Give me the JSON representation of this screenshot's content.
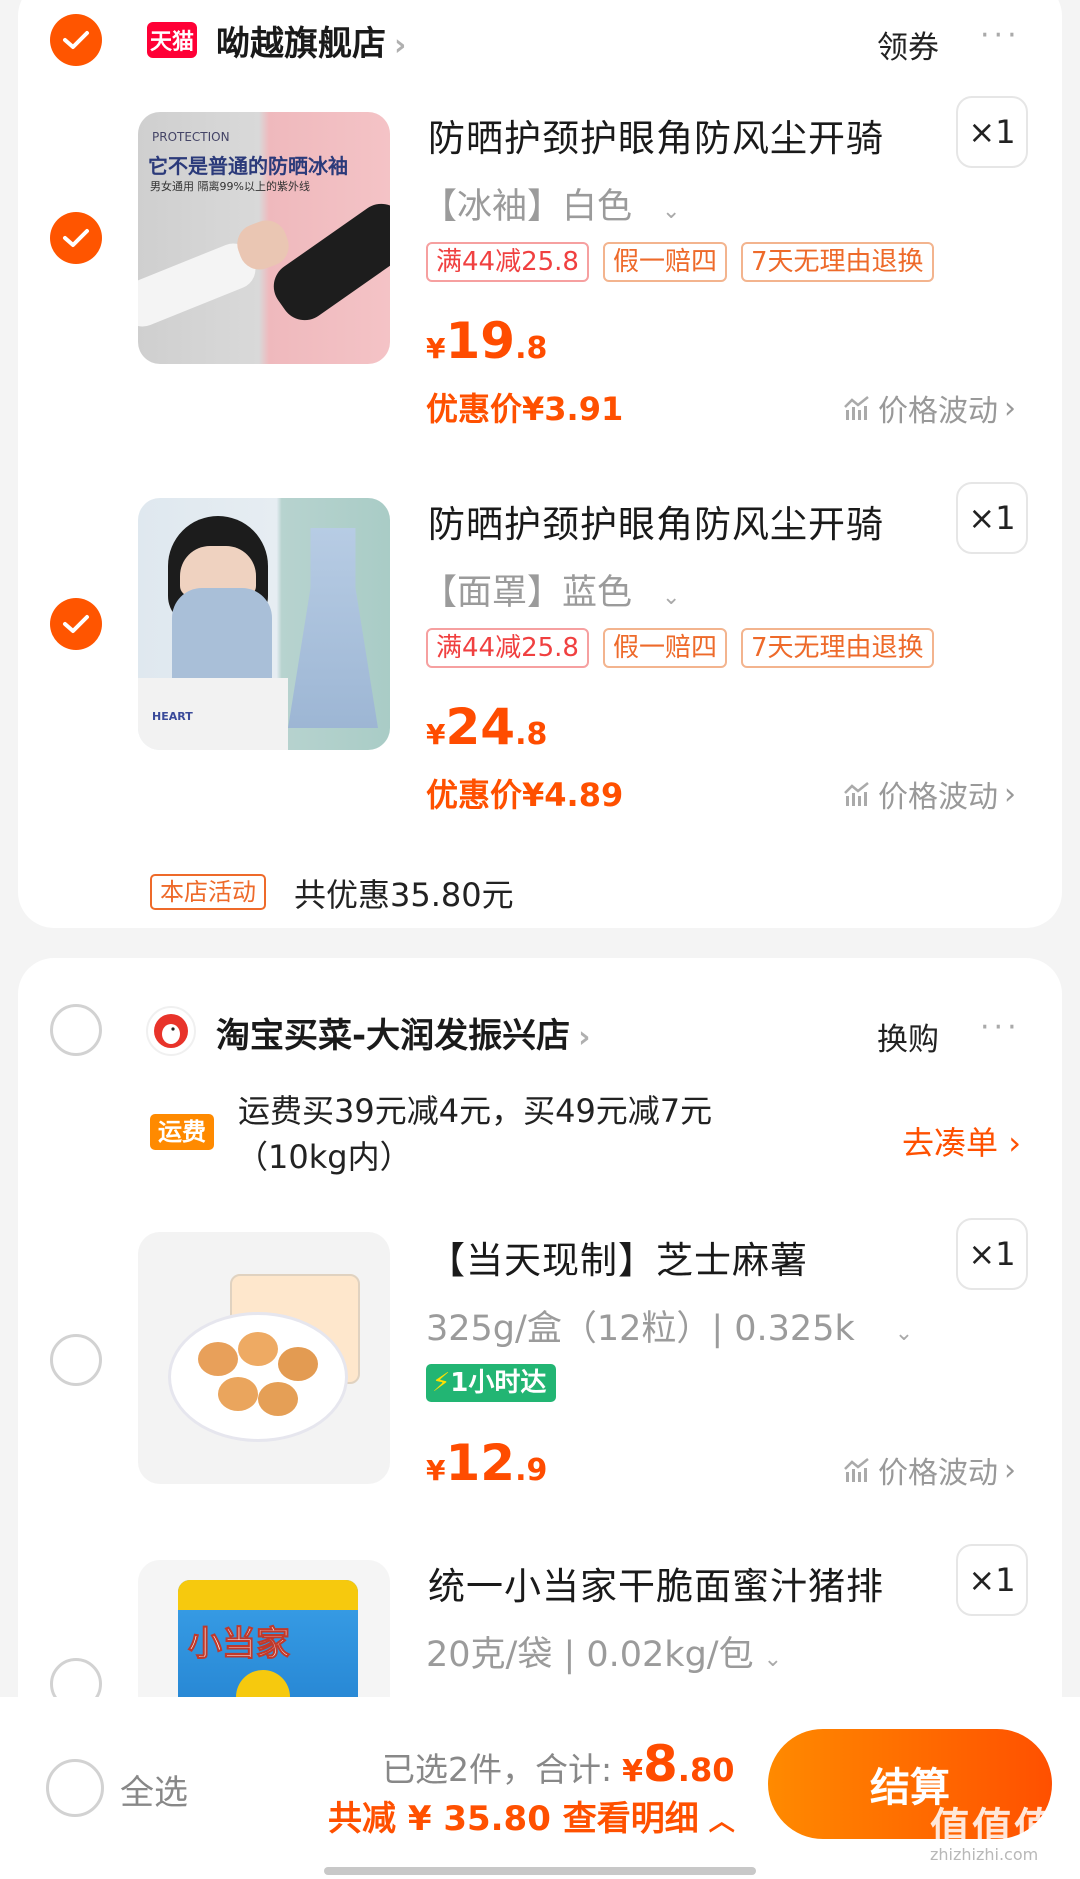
{
  "shop1": {
    "badge": "天猫",
    "name": "呦越旗舰店",
    "action": "领券",
    "items": [
      {
        "title": "防晒护颈护眼角防风尘开骑",
        "sku": "【冰袖】白色",
        "tags": [
          "满44减25.8",
          "假一赔四",
          "7天无理由退换"
        ],
        "price_int": "19",
        "price_dec": ".8",
        "discount": "优惠价¥3.91",
        "qty": "×1",
        "thumb_title": "它不是普通的防晒冰袖",
        "thumb_sub": "男女通用  隔离99%以上的紫外线",
        "thumb_tag": "PROTECTION"
      },
      {
        "title": "防晒护颈护眼角防风尘开骑",
        "sku": "【面罩】蓝色",
        "tags": [
          "满44减25.8",
          "假一赔四",
          "7天无理由退换"
        ],
        "price_int": "24",
        "price_dec": ".8",
        "discount": "优惠价¥4.89",
        "qty": "×1",
        "thumb_text": "HEART"
      }
    ],
    "activity_tag": "本店活动",
    "activity_text": "共优惠35.80元"
  },
  "shop2": {
    "name": "淘宝买菜-大润发振兴店",
    "action": "换购",
    "shipping_tag": "运费",
    "shipping_line1": "运费买39元减4元，买49元减7元",
    "shipping_line2": "（10kg内）",
    "shipping_link": "去凑单",
    "items": [
      {
        "title": "【当天现制】芝士麻薯",
        "sku": "325g/盒（12粒）| 0.325k",
        "badge": "1小时达",
        "price_int": "12",
        "price_dec": ".9",
        "qty": "×1"
      },
      {
        "title": "统一小当家干脆面蜜汁猪排",
        "sku": "20克/袋 | 0.02kg/包",
        "qty": "×1",
        "thumb_text": "小当家"
      }
    ]
  },
  "common": {
    "currency": "¥",
    "trend": "价格波动",
    "more": "···"
  },
  "footer": {
    "select_all": "全选",
    "selected": "已选2件，合计:",
    "total_yen": "¥",
    "total_int": "8",
    "total_dec": ".80",
    "saved": "共减 ¥ 35.80  查看明细",
    "checkout": "结算",
    "watermark": "值值值",
    "watermark_url": "zhizhizhi.com"
  },
  "colors": {
    "accent": "#ff5500",
    "price": "#ff4c00",
    "tag": "#f04040"
  }
}
